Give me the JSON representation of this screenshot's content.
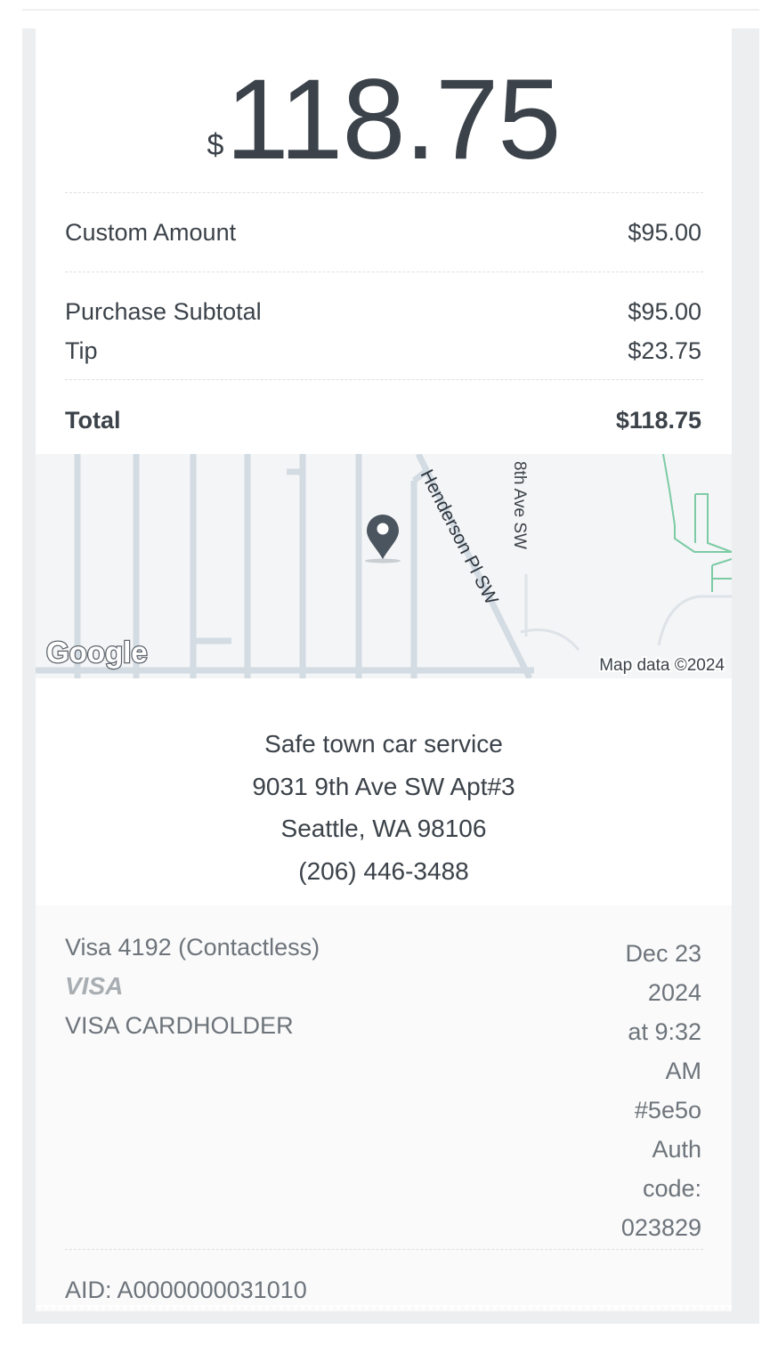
{
  "amount": {
    "currency_symbol": "$",
    "value": "118.75"
  },
  "line_items": [
    {
      "label": "Custom Amount",
      "value": "$95.00"
    }
  ],
  "summary": [
    {
      "label": "Purchase Subtotal",
      "value": "$95.00"
    },
    {
      "label": "Tip",
      "value": "$23.75"
    }
  ],
  "total": {
    "label": "Total",
    "value": "$118.75"
  },
  "map": {
    "streets": [
      "Henderson Pl SW",
      "8th Ave SW"
    ],
    "logo_text": "Google",
    "attribution": "Map data ©2024",
    "pin_icon": "location-pin-icon"
  },
  "merchant": {
    "name": "Safe town car service",
    "address_line1": "9031 9th Ave SW Apt#3",
    "address_line2": "Seattle, WA 98106",
    "phone": "(206) 446-3488"
  },
  "payment": {
    "card": "Visa 4192 (Contactless)",
    "brand_logo": "VISA",
    "cardholder": "VISA CARDHOLDER",
    "date_lines": [
      "Dec 23",
      "2024",
      "at 9:32",
      "AM",
      "#5e5o",
      "Auth",
      "code:",
      "023829"
    ]
  },
  "aid": "AID: A0000000031010",
  "colors": {
    "text_primary": "#3b4249",
    "text_secondary": "#6d747b",
    "map_road": "#d3dbe3",
    "map_park": "#7ccba5",
    "pin": "#4b5560"
  }
}
